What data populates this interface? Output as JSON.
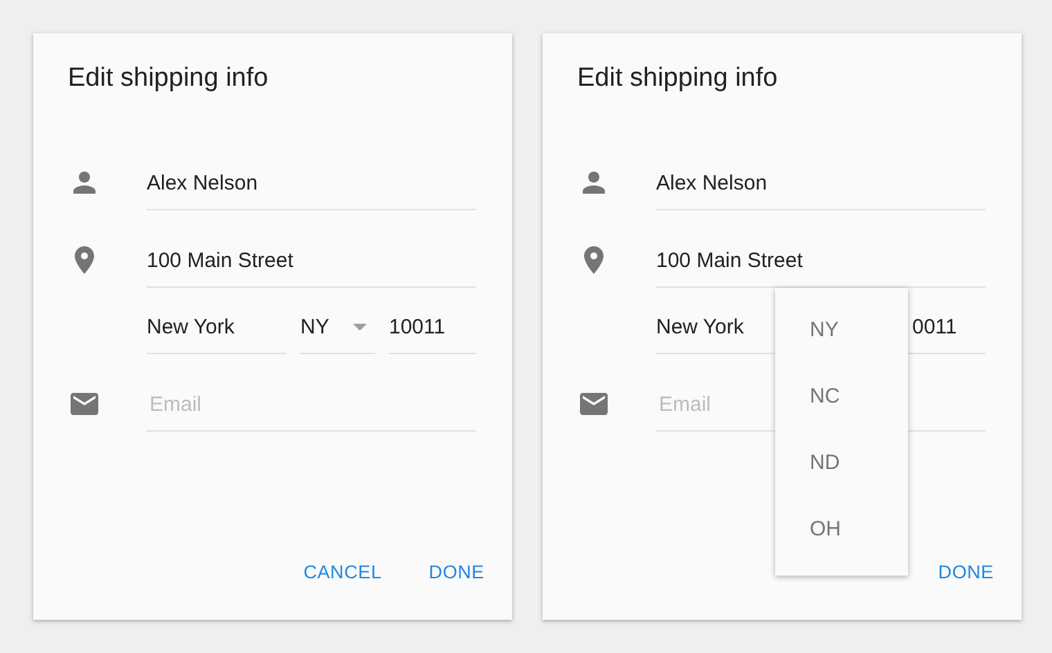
{
  "dialogs": [
    {
      "title": "Edit shipping info",
      "name": "Alex Nelson",
      "address": "100 Main Street",
      "city": "New York",
      "state": "NY",
      "zip": "10011",
      "email_placeholder": "Email",
      "state_menu": {
        "open": false
      },
      "buttons": [
        "CANCEL",
        "DONE"
      ]
    },
    {
      "title": "Edit shipping info",
      "name": "Alex Nelson",
      "address": "100 Main Street",
      "city": "New York",
      "zip": "0011",
      "email_placeholder": "Email",
      "state_menu": {
        "open": true,
        "options": [
          "NY",
          "NC",
          "ND",
          "OH"
        ]
      },
      "buttons": [
        "DONE"
      ]
    }
  ]
}
